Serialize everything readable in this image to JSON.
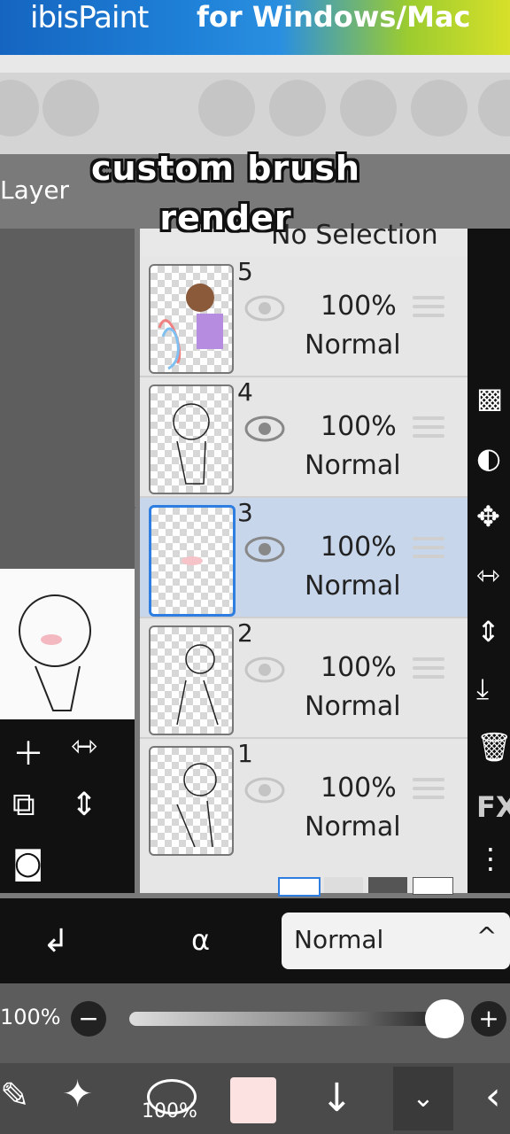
{
  "banner": {
    "brand": "ibisPaint",
    "subtitle": "for Windows/Mac"
  },
  "overlay_caption": "custom brush render",
  "panel_title": "Layer",
  "selection_label": "No Selection",
  "layers": [
    {
      "number": "5",
      "opacity": "100%",
      "blend": "Normal",
      "visible": true,
      "selected": false
    },
    {
      "number": "4",
      "opacity": "100%",
      "blend": "Normal",
      "visible": true,
      "selected": false
    },
    {
      "number": "3",
      "opacity": "100%",
      "blend": "Normal",
      "visible": true,
      "selected": true
    },
    {
      "number": "2",
      "opacity": "100%",
      "blend": "Normal",
      "visible": true,
      "selected": false
    },
    {
      "number": "1",
      "opacity": "100%",
      "blend": "Normal",
      "visible": true,
      "selected": false
    }
  ],
  "blend_mode": {
    "value": "Normal"
  },
  "opacity": {
    "label": "100%",
    "value": 1.0
  },
  "bottom": {
    "brush_size": "100%"
  },
  "right_tools": {
    "fx_label": "FX"
  },
  "colors": {
    "selection_blue": "#2e7de0",
    "selected_row": "#c7d6ea",
    "current_color": "#fde2e2"
  }
}
